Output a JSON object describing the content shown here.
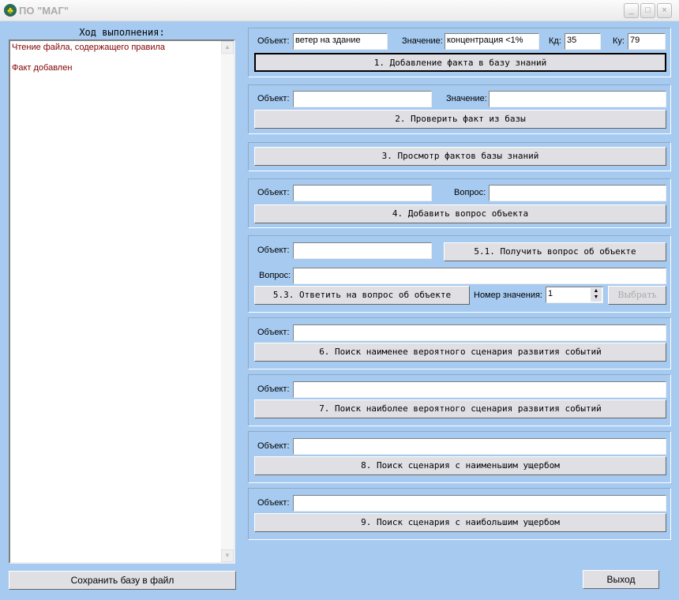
{
  "window": {
    "title": "ПО \"МАГ\"",
    "icon": "app-icon",
    "controls": [
      "_",
      "□",
      "×"
    ]
  },
  "left": {
    "label": "Ход выполнения:",
    "log": [
      "Чтение файла, содержащего правила",
      "Факт добавлен"
    ],
    "save_button": "Сохранить базу в файл"
  },
  "p1": {
    "object_label": "Объект:",
    "object_value": "ветер на здание",
    "value_label": "Значение:",
    "value_value": "концентрация <1%",
    "kd_label": "Кд:",
    "kd_value": "35",
    "ku_label": "Ку:",
    "ku_value": "79",
    "button": "1. Добавление факта в базу знаний"
  },
  "p2": {
    "object_label": "Объект:",
    "value_label": "Значение:",
    "button": "2. Проверить факт из базы"
  },
  "p3": {
    "button": "3. Просмотр фактов базы знаний"
  },
  "p4": {
    "object_label": "Объект:",
    "question_label": "Вопрос:",
    "button": "4. Добавить вопрос объекта"
  },
  "p5": {
    "object_label": "Объект:",
    "get_button": "5.1. Получить вопрос об объекте",
    "question_label": "Вопрос:",
    "answer_button": "5.3. Ответить на вопрос об объекте",
    "number_label": "Номер значения:",
    "number_value": "1",
    "select_button": "Выбрать"
  },
  "p6": {
    "object_label": "Объект:",
    "button": "6. Поиск наименее вероятного сценария развития событий"
  },
  "p7": {
    "object_label": "Объект:",
    "button": "7. Поиск наиболее вероятного сценария развития событий"
  },
  "p8": {
    "object_label": "Объект:",
    "button": "8. Поиск сценария с наименьшим ущербом"
  },
  "p9": {
    "object_label": "Объект:",
    "button": "9. Поиск сценария с наибольшим ущербом"
  },
  "exit_button": "Выход"
}
